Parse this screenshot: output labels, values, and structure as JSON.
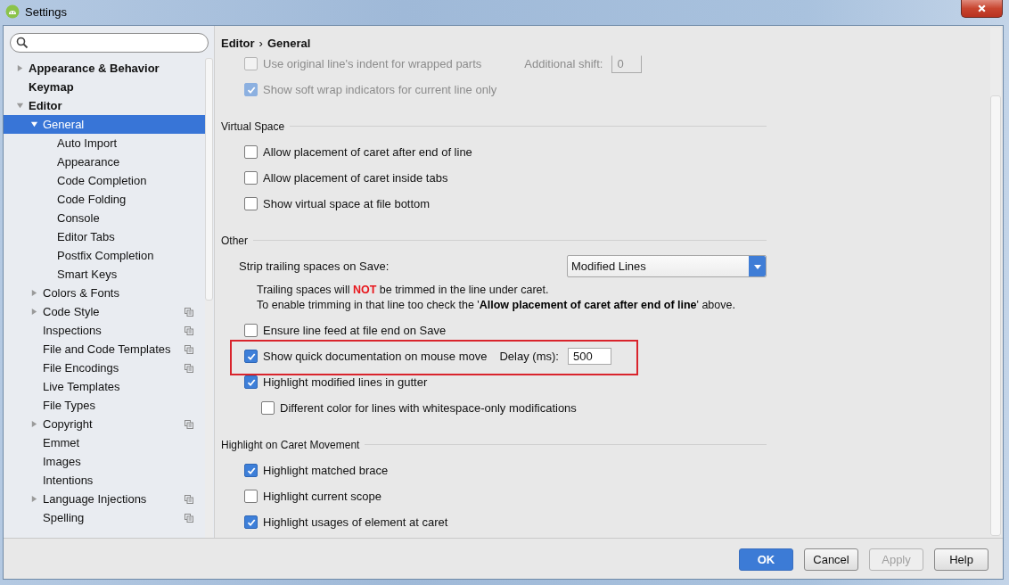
{
  "window": {
    "title": "Settings"
  },
  "sidebar": {
    "items": [
      {
        "label": "Appearance & Behavior",
        "kind": "group",
        "expanded": false,
        "selected": false,
        "project_scoped": false
      },
      {
        "label": "Keymap",
        "kind": "leaf",
        "selected": false,
        "project_scoped": false
      },
      {
        "label": "Editor",
        "kind": "group",
        "expanded": true,
        "selected": false,
        "project_scoped": false,
        "children": [
          {
            "label": "General",
            "kind": "group",
            "expanded": true,
            "selected": true,
            "project_scoped": false,
            "children": [
              {
                "label": "Auto Import",
                "kind": "leaf",
                "selected": false,
                "project_scoped": false
              },
              {
                "label": "Appearance",
                "kind": "leaf",
                "selected": false,
                "project_scoped": false
              },
              {
                "label": "Code Completion",
                "kind": "leaf",
                "selected": false,
                "project_scoped": false
              },
              {
                "label": "Code Folding",
                "kind": "leaf",
                "selected": false,
                "project_scoped": false
              },
              {
                "label": "Console",
                "kind": "leaf",
                "selected": false,
                "project_scoped": false
              },
              {
                "label": "Editor Tabs",
                "kind": "leaf",
                "selected": false,
                "project_scoped": false
              },
              {
                "label": "Postfix Completion",
                "kind": "leaf",
                "selected": false,
                "project_scoped": false
              },
              {
                "label": "Smart Keys",
                "kind": "leaf",
                "selected": false,
                "project_scoped": false
              }
            ]
          },
          {
            "label": "Colors & Fonts",
            "kind": "group",
            "expanded": false,
            "selected": false,
            "project_scoped": false
          },
          {
            "label": "Code Style",
            "kind": "group",
            "expanded": false,
            "selected": false,
            "project_scoped": true
          },
          {
            "label": "Inspections",
            "kind": "leaf",
            "selected": false,
            "project_scoped": true
          },
          {
            "label": "File and Code Templates",
            "kind": "leaf",
            "selected": false,
            "project_scoped": true
          },
          {
            "label": "File Encodings",
            "kind": "leaf",
            "selected": false,
            "project_scoped": true
          },
          {
            "label": "Live Templates",
            "kind": "leaf",
            "selected": false,
            "project_scoped": false
          },
          {
            "label": "File Types",
            "kind": "leaf",
            "selected": false,
            "project_scoped": false
          },
          {
            "label": "Copyright",
            "kind": "group",
            "expanded": false,
            "selected": false,
            "project_scoped": true
          },
          {
            "label": "Emmet",
            "kind": "leaf",
            "selected": false,
            "project_scoped": false
          },
          {
            "label": "Images",
            "kind": "leaf",
            "selected": false,
            "project_scoped": false
          },
          {
            "label": "Intentions",
            "kind": "leaf",
            "selected": false,
            "project_scoped": false
          },
          {
            "label": "Language Injections",
            "kind": "group",
            "expanded": false,
            "selected": false,
            "project_scoped": true
          },
          {
            "label": "Spelling",
            "kind": "leaf",
            "selected": false,
            "project_scoped": true
          }
        ]
      }
    ]
  },
  "breadcrumb": {
    "parts": [
      "Editor",
      "General"
    ],
    "separator": "›"
  },
  "settings": [
    {
      "kind": "checkbox",
      "label": "Use original line's indent for wrapped parts",
      "checked": false,
      "disabled": true,
      "highlighted": false,
      "extra": {
        "label": "Additional shift:",
        "value": "0"
      }
    },
    {
      "kind": "checkbox",
      "label": "Show soft wrap indicators for current line only",
      "checked": true,
      "disabled": true,
      "highlighted": false
    },
    {
      "kind": "section",
      "label": "Virtual Space"
    },
    {
      "kind": "checkbox",
      "label": "Allow placement of caret after end of line",
      "checked": false,
      "disabled": false,
      "highlighted": false
    },
    {
      "kind": "checkbox",
      "label": "Allow placement of caret inside tabs",
      "checked": false,
      "disabled": false,
      "highlighted": false
    },
    {
      "kind": "checkbox",
      "label": "Show virtual space at file bottom",
      "checked": false,
      "disabled": false,
      "highlighted": false
    },
    {
      "kind": "section",
      "label": "Other"
    },
    {
      "kind": "select",
      "label": "Strip trailing spaces on Save:",
      "value": "Modified Lines"
    },
    {
      "kind": "note",
      "lines": [
        {
          "text": "Trailing spaces will **NOT** be trimmed in the line under caret.",
          "color": "#e8151b"
        },
        {
          "text": "To enable trimming in that line too check the '**Allow placement of caret after end of line**' above.",
          "color": "#000000"
        }
      ]
    },
    {
      "kind": "checkbox",
      "label": "Ensure line feed at file end on Save",
      "checked": false,
      "disabled": false,
      "highlighted": false
    },
    {
      "kind": "checkbox",
      "label": "Show quick documentation on mouse move",
      "checked": true,
      "disabled": false,
      "highlighted": true,
      "extra": {
        "label": "Delay (ms):",
        "value": "500"
      }
    },
    {
      "kind": "checkbox",
      "label": "Highlight modified lines in gutter",
      "checked": true,
      "disabled": false,
      "highlighted": false,
      "children": [
        {
          "kind": "checkbox",
          "label": "Different color for lines with whitespace-only modifications",
          "checked": false,
          "disabled": false,
          "highlighted": false
        }
      ]
    },
    {
      "kind": "section",
      "label": "Highlight on Caret Movement"
    },
    {
      "kind": "checkbox",
      "label": "Highlight matched brace",
      "checked": true,
      "disabled": false,
      "highlighted": false
    },
    {
      "kind": "checkbox",
      "label": "Highlight current scope",
      "checked": false,
      "disabled": false,
      "highlighted": false
    },
    {
      "kind": "checkbox",
      "label": "Highlight usages of element at caret",
      "checked": true,
      "disabled": false,
      "highlighted": false
    }
  ],
  "buttons": [
    {
      "label": "OK",
      "kind": "primary",
      "disabled": false
    },
    {
      "label": "Cancel",
      "kind": "normal",
      "disabled": false
    },
    {
      "label": "Apply",
      "kind": "normal",
      "disabled": true
    },
    {
      "label": "Help",
      "kind": "normal",
      "disabled": false
    }
  ]
}
